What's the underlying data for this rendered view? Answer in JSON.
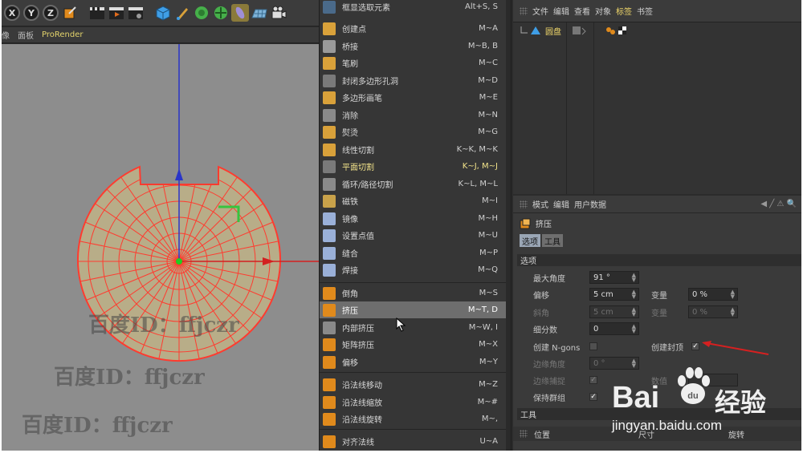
{
  "toolbar": {
    "axes": [
      "X",
      "Y",
      "Z"
    ]
  },
  "viewport_menu": {
    "items": [
      "像",
      "面板",
      "ProRender"
    ]
  },
  "watermarks": [
    "百度ID：ffjczr",
    "百度ID：ffjczr",
    "百度ID：ffjczr"
  ],
  "context_menu": {
    "items": [
      {
        "label": "框显选取元素",
        "shortcut": "Alt+S, S"
      },
      {
        "label": "创建点",
        "shortcut": "M~A"
      },
      {
        "label": "桥接",
        "shortcut": "M~B, B"
      },
      {
        "label": "笔刷",
        "shortcut": "M~C"
      },
      {
        "label": "封闭多边形孔洞",
        "shortcut": "M~D"
      },
      {
        "label": "多边形画笔",
        "shortcut": "M~E"
      },
      {
        "label": "消除",
        "shortcut": "M~N"
      },
      {
        "label": "熨烫",
        "shortcut": "M~G"
      },
      {
        "label": "线性切割",
        "shortcut": "K~K, M~K"
      },
      {
        "label": "平面切割",
        "shortcut": "K~J, M~J"
      },
      {
        "label": "循环/路径切割",
        "shortcut": "K~L, M~L"
      },
      {
        "label": "磁铁",
        "shortcut": "M~I"
      },
      {
        "label": "镜像",
        "shortcut": "M~H"
      },
      {
        "label": "设置点值",
        "shortcut": "M~U"
      },
      {
        "label": "缝合",
        "shortcut": "M~P"
      },
      {
        "label": "焊接",
        "shortcut": "M~Q"
      },
      {
        "label": "倒角",
        "shortcut": "M~S"
      },
      {
        "label": "挤压",
        "shortcut": "M~T, D"
      },
      {
        "label": "内部挤压",
        "shortcut": "M~W, I"
      },
      {
        "label": "矩阵挤压",
        "shortcut": "M~X"
      },
      {
        "label": "偏移",
        "shortcut": "M~Y"
      },
      {
        "label": "沿法线移动",
        "shortcut": "M~Z"
      },
      {
        "label": "沿法线缩放",
        "shortcut": "M~#"
      },
      {
        "label": "沿法线旋转",
        "shortcut": "M~,"
      },
      {
        "label": "对齐法线",
        "shortcut": "U~A"
      }
    ]
  },
  "object_manager": {
    "menu": [
      "文件",
      "编辑",
      "查看",
      "对象",
      "标签",
      "书签"
    ],
    "object_name": "圆盘"
  },
  "attribute_manager": {
    "menu": [
      "模式",
      "编辑",
      "用户数据"
    ],
    "title": "挤压",
    "tabs": [
      "选项",
      "工具"
    ],
    "section_options": "选项",
    "section_tool": "工具",
    "max_angle_label": "最大角度",
    "max_angle_value": "91 °",
    "offset_label": "偏移",
    "offset_value": "5 cm",
    "var1_label": "变量",
    "var1_value": "0 %",
    "bevel_label": "斜角",
    "bevel_value": "5 cm",
    "var2_label": "变量",
    "var2_value": "0 %",
    "subdiv_label": "细分数",
    "subdiv_value": "0",
    "ngons_label": "创建 N-gons",
    "cap_label": "创建封顶",
    "edge_angle_label": "边缘角度",
    "edge_angle_value": "0 °",
    "edge_snap_label": "边缘捕捉",
    "count_label": "数值",
    "keep_groups_label": "保持群组",
    "coords_label": "位置",
    "coords_size_label": "尺寸",
    "coords_rot_label": "旋转"
  },
  "baidu": {
    "logo_text": "Bai",
    "logo_text2": "经验",
    "url": "jingyan.baidu.com"
  },
  "colors": {
    "highlight_yellow": "#f0d76a",
    "mesh_red": "#ff3b2f",
    "disk_fill": "#b8ad88",
    "arrow_red": "#d62020"
  }
}
